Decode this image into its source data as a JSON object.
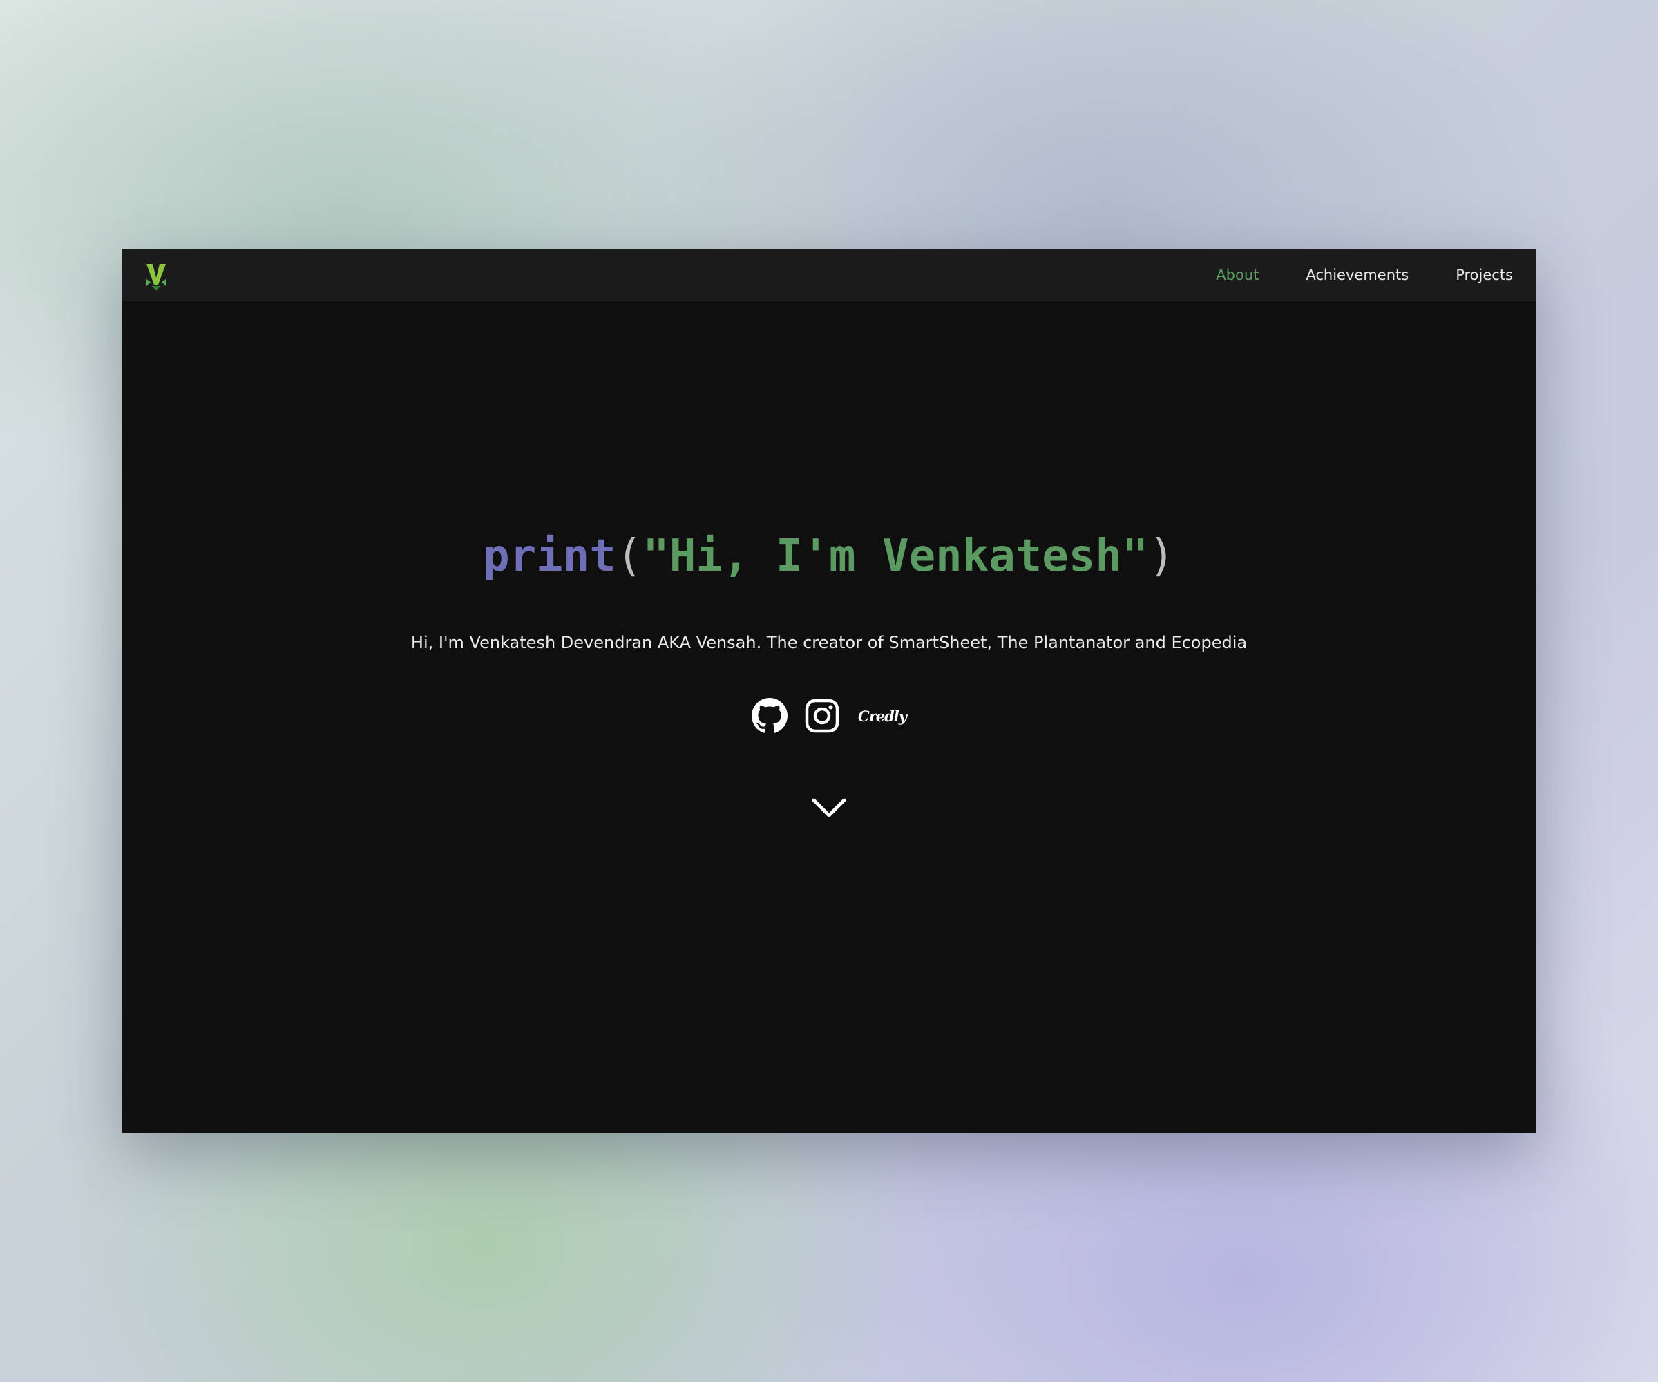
{
  "navbar": {
    "logo_icon": "v-logo-icon",
    "links": [
      {
        "label": "About",
        "active": true
      },
      {
        "label": "Achievements",
        "active": false
      },
      {
        "label": "Projects",
        "active": false
      }
    ]
  },
  "hero": {
    "code_keyword": "print",
    "code_open": "(",
    "code_string": "\"Hi, I'm Venkatesh\"",
    "code_close": ")",
    "subtitle": "Hi, I'm Venkatesh Devendran AKA Vensah. The creator of SmartSheet, The Plantanator and Ecopedia",
    "socials": {
      "github_icon": "github-icon",
      "instagram_icon": "instagram-icon",
      "credly_label": "Credly"
    },
    "scroll_icon": "chevron-down-icon"
  },
  "colors": {
    "window_bg": "#0f0f0f",
    "navbar_bg": "#1b1b1b",
    "accent_green": "#5a9e5e",
    "keyword_purple": "#6f6fb8",
    "text": "#ececec"
  }
}
